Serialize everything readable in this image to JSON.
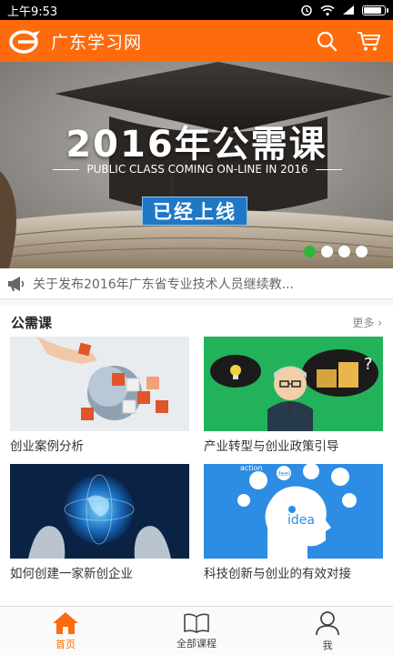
{
  "statusbar": {
    "time": "上午9:53",
    "battery_level": 0.9
  },
  "header": {
    "title": "广东学习网",
    "brand_color": "#fd6b0d",
    "search_icon": "search-icon",
    "cart_icon": "cart-icon"
  },
  "banner": {
    "title": "2016年公需课",
    "subtitle": "PUBLIC CLASS COMING ON-LINE IN 2016",
    "badge": "已经上线",
    "slide_count": 4,
    "active_slide": 1
  },
  "notice": {
    "icon": "megaphone-icon",
    "text": "关于发布2016年广东省专业技术人员继续教..."
  },
  "section": {
    "title": "公需课",
    "more": "更多",
    "courses": [
      {
        "label": "创业案例分析"
      },
      {
        "label": "产业转型与创业政策引导"
      },
      {
        "label": "如何创建一家新创企业"
      },
      {
        "label": "科技创新与创业的有效对接"
      }
    ],
    "card2_thumb_text": {
      "hint": "?",
      "person": ""
    },
    "card4_thumb_text": {
      "idea": "idea",
      "action": "action",
      "feel": "feel"
    }
  },
  "bottomnav": {
    "items": [
      {
        "label": "首页",
        "icon": "home-icon",
        "active": true
      },
      {
        "label": "全部课程",
        "icon": "book-icon",
        "active": false
      },
      {
        "label": "我",
        "icon": "user-icon",
        "active": false
      }
    ]
  }
}
